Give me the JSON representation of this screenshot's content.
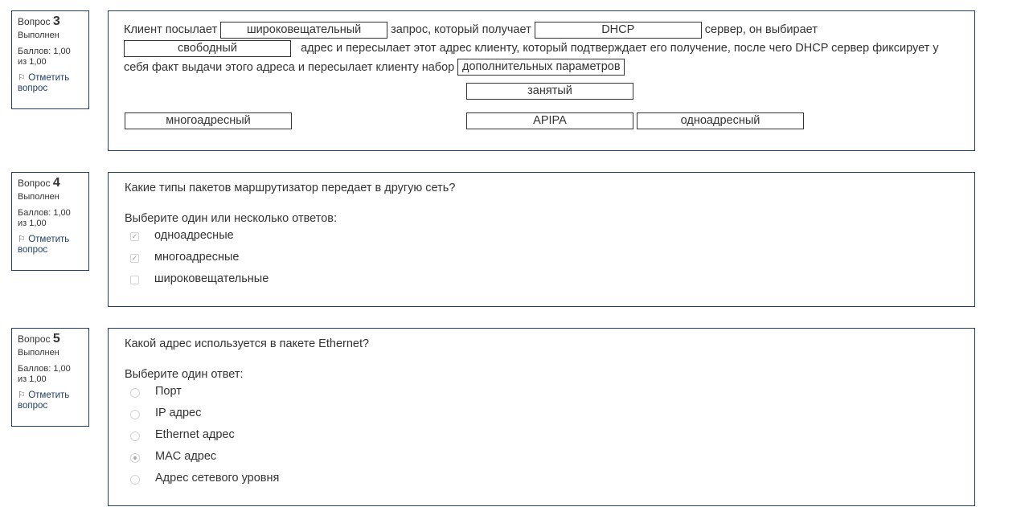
{
  "q3": {
    "label": "Вопрос",
    "number": "3",
    "state": "Выполнен",
    "grade_line1": "Баллов: 1,00",
    "grade_line2": "из 1,00",
    "flag_line1": "Отметить",
    "flag_line2": "вопрос",
    "text_1": "Клиент посылает",
    "gap_1": "широковещательный",
    "text_2": "запрос, который получает",
    "gap_2": "DHCP",
    "text_3": "сервер, он выбирает",
    "gap_3": "свободный",
    "text_4": "адрес и пересылает этот адрес клиенту, который подтверждает его получение, после чего DHCP сервер фиксирует у себя факт выдачи этого адреса и пересылает клиенту набор",
    "gap_4": "дополнительных параметров",
    "choices": [
      "занятый",
      "многоадресный",
      "APIPA",
      "одноадресный"
    ]
  },
  "q4": {
    "label": "Вопрос",
    "number": "4",
    "state": "Выполнен",
    "grade_line1": "Баллов: 1,00",
    "grade_line2": "из 1,00",
    "flag_line1": "Отметить",
    "flag_line2": "вопрос",
    "question": "Какие типы пакетов маршрутизатор передает в другую сеть?",
    "prompt": "Выберите один или несколько ответов:",
    "options": [
      {
        "label": "одноадресные",
        "checked": true
      },
      {
        "label": "многоадресные",
        "checked": true
      },
      {
        "label": "широковещательные",
        "checked": false
      }
    ]
  },
  "q5": {
    "label": "Вопрос",
    "number": "5",
    "state": "Выполнен",
    "grade_line1": "Баллов: 1,00",
    "grade_line2": "из 1,00",
    "flag_line1": "Отметить",
    "flag_line2": "вопрос",
    "question": "Какой адрес используется в пакете Ethernet?",
    "prompt": "Выберите один ответ:",
    "options": [
      {
        "label": "Порт",
        "selected": false
      },
      {
        "label": "IP адрес",
        "selected": false
      },
      {
        "label": "Ethernet адрес",
        "selected": false
      },
      {
        "label": "MAC адрес",
        "selected": true
      },
      {
        "label": "Адрес сетевого уровня",
        "selected": false
      }
    ]
  },
  "icons": {
    "flag": "flag-icon",
    "check": "checkmark-icon"
  }
}
